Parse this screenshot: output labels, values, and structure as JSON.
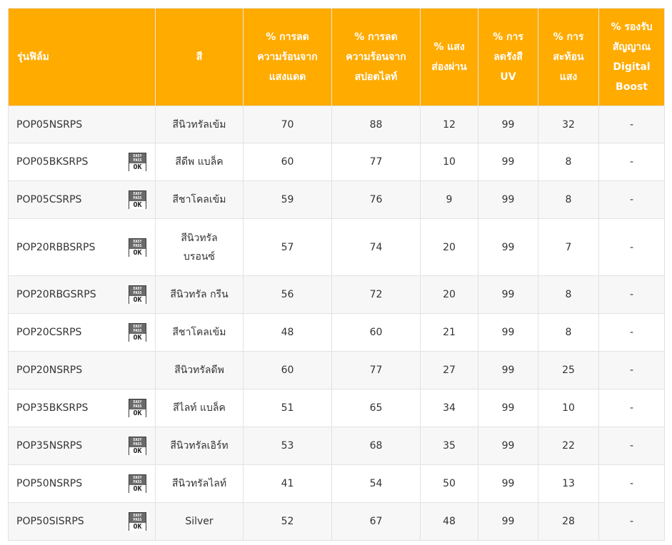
{
  "colors": {
    "header_bg": "#ffab00",
    "header_text": "#ffffff",
    "row_alt": "#f7f7f7"
  },
  "table": {
    "headers": [
      {
        "lines": [
          "รุ่นฟิล์ม"
        ]
      },
      {
        "lines": [
          "สี"
        ]
      },
      {
        "lines": [
          "% การลด",
          "ความร้อนจาก",
          "แสงแดด"
        ]
      },
      {
        "lines": [
          "% การลด",
          "ความร้อนจาก",
          "สปอตไลท์"
        ]
      },
      {
        "lines": [
          "% แสง",
          "ส่องผ่าน"
        ]
      },
      {
        "lines": [
          "% การ",
          "ลดรังสี",
          "UV"
        ]
      },
      {
        "lines": [
          "% การ",
          "สะท้อน",
          "แสง"
        ]
      },
      {
        "lines": [
          "% รองรับ",
          "สัญญาณ",
          "Digital",
          "Boost"
        ]
      }
    ],
    "badge": {
      "top": "EASY",
      "mid": "PASS",
      "ok": "OK"
    },
    "rows": [
      {
        "model": "POP05NSRPS",
        "badge": false,
        "color": [
          "สีนิวทรัลเข้ม"
        ],
        "sun": "70",
        "spot": "88",
        "vlt": "12",
        "uv": "99",
        "refl": "32",
        "digital": "-"
      },
      {
        "model": "POP05BKSRPS",
        "badge": true,
        "color": [
          "สีดีพ แบล็ค"
        ],
        "sun": "60",
        "spot": "77",
        "vlt": "10",
        "uv": "99",
        "refl": "8",
        "digital": "-"
      },
      {
        "model": "POP05CSRPS",
        "badge": true,
        "color": [
          "สีชาโคลเข้ม"
        ],
        "sun": "59",
        "spot": "76",
        "vlt": "9",
        "uv": "99",
        "refl": "8",
        "digital": "-"
      },
      {
        "model": "POP20RBBSRPS",
        "badge": true,
        "color": [
          "สีนิวทรัล",
          "บรอนซ์"
        ],
        "sun": "57",
        "spot": "74",
        "vlt": "20",
        "uv": "99",
        "refl": "7",
        "digital": "-"
      },
      {
        "model": "POP20RBGSRPS",
        "badge": true,
        "color": [
          "สีนิวทรัล กรีน"
        ],
        "sun": "56",
        "spot": "72",
        "vlt": "20",
        "uv": "99",
        "refl": "8",
        "digital": "-"
      },
      {
        "model": "POP20CSRPS",
        "badge": true,
        "color": [
          "สีชาโคลเข้ม"
        ],
        "sun": "48",
        "spot": "60",
        "vlt": "21",
        "uv": "99",
        "refl": "8",
        "digital": "-"
      },
      {
        "model": "POP20NSRPS",
        "badge": false,
        "color": [
          "สีนิวทรัลดีพ"
        ],
        "sun": "60",
        "spot": "77",
        "vlt": "27",
        "uv": "99",
        "refl": "25",
        "digital": "-"
      },
      {
        "model": "POP35BKSRPS",
        "badge": true,
        "color": [
          "สีไลท์ แบล็ค"
        ],
        "sun": "51",
        "spot": "65",
        "vlt": "34",
        "uv": "99",
        "refl": "10",
        "digital": "-"
      },
      {
        "model": "POP35NSRPS",
        "badge": true,
        "color": [
          "สีนิวทรัลเอิร์ท"
        ],
        "sun": "53",
        "spot": "68",
        "vlt": "35",
        "uv": "99",
        "refl": "22",
        "digital": "-"
      },
      {
        "model": "POP50NSRPS",
        "badge": true,
        "color": [
          "สีนิวทรัลไลท์"
        ],
        "sun": "41",
        "spot": "54",
        "vlt": "50",
        "uv": "99",
        "refl": "13",
        "digital": "-"
      },
      {
        "model": "POP50SISRPS",
        "badge": true,
        "color": [
          "Silver"
        ],
        "sun": "52",
        "spot": "67",
        "vlt": "48",
        "uv": "99",
        "refl": "28",
        "digital": "-"
      }
    ]
  }
}
